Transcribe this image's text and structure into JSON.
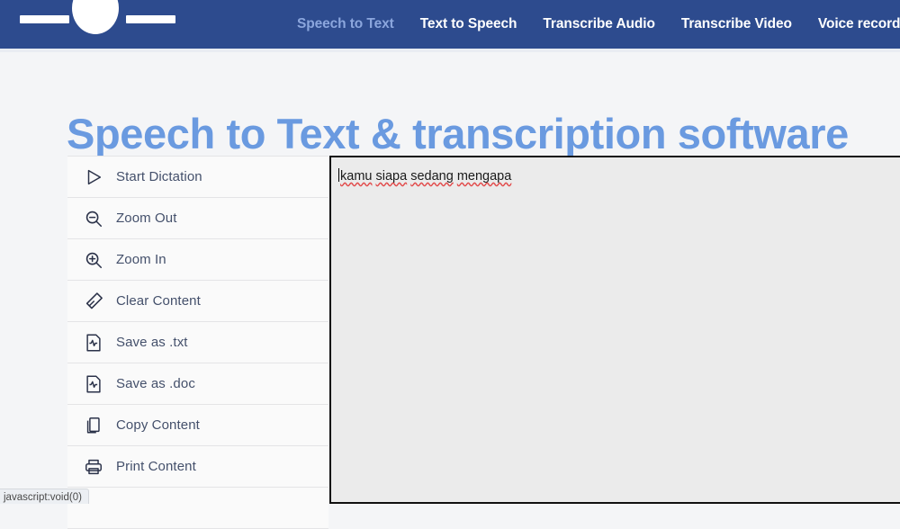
{
  "navbar": {
    "logo_name": "speech-wave-logo",
    "brand_color": "#2d4b8e",
    "links": [
      {
        "label": "Speech to Text",
        "active": true
      },
      {
        "label": "Text to Speech",
        "active": false
      },
      {
        "label": "Transcribe Audio",
        "active": false
      },
      {
        "label": "Transcribe Video",
        "active": false
      },
      {
        "label": "Voice recorder",
        "active": false
      }
    ]
  },
  "hero": {
    "title": "Speech to Text & transcription software",
    "title_color": "#6a9ae0"
  },
  "sidebar": {
    "items": [
      {
        "label": "Start Dictation",
        "icon": "play-icon"
      },
      {
        "label": "Zoom Out",
        "icon": "zoom-out-icon"
      },
      {
        "label": "Zoom In",
        "icon": "zoom-in-icon"
      },
      {
        "label": "Clear Content",
        "icon": "eraser-icon"
      },
      {
        "label": "Save as .txt",
        "icon": "save-file-icon"
      },
      {
        "label": "Save as .doc",
        "icon": "save-file-icon"
      },
      {
        "label": "Copy Content",
        "icon": "copy-icon"
      },
      {
        "label": "Print Content",
        "icon": "printer-icon"
      }
    ]
  },
  "editor": {
    "words": [
      "kamu",
      "siapa",
      "sedang",
      "mengapa"
    ],
    "text": "kamu siapa sedang mengapa",
    "spellcheck_underline_color": "#e24a4a",
    "background": "#ebebeb"
  },
  "status_bar": {
    "text": "javascript:void(0)"
  }
}
